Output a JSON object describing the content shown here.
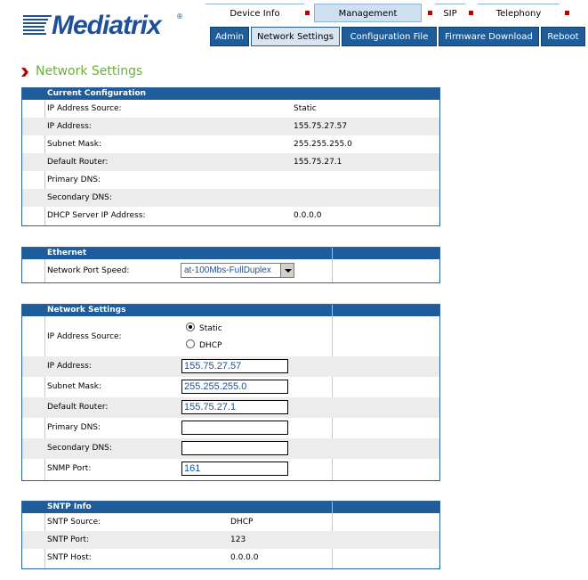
{
  "brand": {
    "name": "Mediatrix",
    "reg": "®"
  },
  "topnav": [
    {
      "label": "Device Info"
    },
    {
      "label": "Management"
    },
    {
      "label": "SIP"
    },
    {
      "label": "Telephony"
    }
  ],
  "subnav": [
    {
      "label": "Admin"
    },
    {
      "label": "Network Settings"
    },
    {
      "label": "Configuration File"
    },
    {
      "label": "Firmware Download"
    },
    {
      "label": "Reboot"
    }
  ],
  "page_title": "Network Settings",
  "current_config": {
    "header": "Current Configuration",
    "rows": [
      {
        "label": "IP Address Source:",
        "value": "Static"
      },
      {
        "label": "IP Address:",
        "value": "155.75.27.57"
      },
      {
        "label": "Subnet Mask:",
        "value": "255.255.255.0"
      },
      {
        "label": "Default Router:",
        "value": "155.75.27.1"
      },
      {
        "label": "Primary DNS:",
        "value": ""
      },
      {
        "label": "Secondary DNS:",
        "value": ""
      },
      {
        "label": "DHCP Server IP Address:",
        "value": "0.0.0.0"
      }
    ]
  },
  "ethernet": {
    "header": "Ethernet",
    "port_speed_label": "Network Port Speed:",
    "port_speed_value": "at-100Mbs-FullDuplex"
  },
  "network_settings": {
    "header": "Network Settings",
    "source_label": "IP Address Source:",
    "source_options": [
      "Static",
      "DHCP"
    ],
    "source_selected": "Static",
    "fields": [
      {
        "label": "IP Address:",
        "value": "155.75.27.57"
      },
      {
        "label": "Subnet Mask:",
        "value": "255.255.255.0"
      },
      {
        "label": "Default Router:",
        "value": "155.75.27.1"
      },
      {
        "label": "Primary DNS:",
        "value": ""
      },
      {
        "label": "Secondary DNS:",
        "value": ""
      },
      {
        "label": "SNMP Port:",
        "value": "161"
      }
    ]
  },
  "sntp": {
    "header": "SNTP Info",
    "rows": [
      {
        "label": "SNTP Source:",
        "value": "DHCP"
      },
      {
        "label": "SNTP Port:",
        "value": "123"
      },
      {
        "label": "SNTP Host:",
        "value": "0.0.0.0"
      }
    ]
  },
  "colors": {
    "header_blue": "#1e5d9a",
    "title_green": "#6cae3a",
    "active_tab": "#cfe0f1",
    "nav_marker_red": "#c00000"
  }
}
